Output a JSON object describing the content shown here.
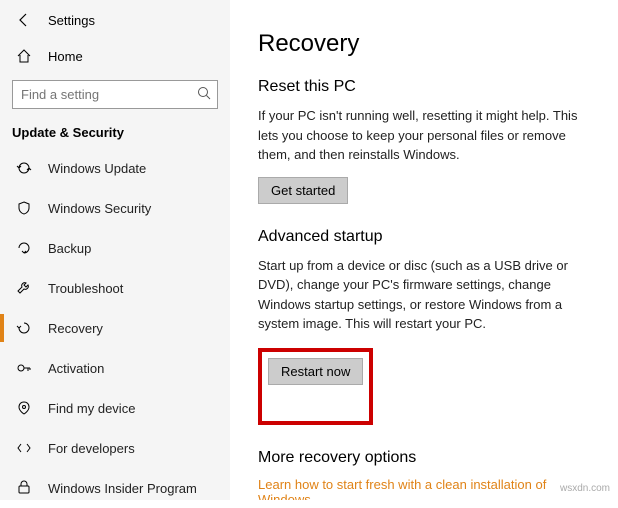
{
  "window": {
    "title": "Settings"
  },
  "sidebar": {
    "home": "Home",
    "search_placeholder": "Find a setting",
    "section": "Update & Security",
    "items": [
      {
        "label": "Windows Update"
      },
      {
        "label": "Windows Security"
      },
      {
        "label": "Backup"
      },
      {
        "label": "Troubleshoot"
      },
      {
        "label": "Recovery"
      },
      {
        "label": "Activation"
      },
      {
        "label": "Find my device"
      },
      {
        "label": "For developers"
      },
      {
        "label": "Windows Insider Program"
      }
    ]
  },
  "main": {
    "heading": "Recovery",
    "reset": {
      "title": "Reset this PC",
      "desc": "If your PC isn't running well, resetting it might help. This lets you choose to keep your personal files or remove them, and then reinstalls Windows.",
      "button": "Get started"
    },
    "advanced": {
      "title": "Advanced startup",
      "desc": "Start up from a device or disc (such as a USB drive or DVD), change your PC's firmware settings, change Windows startup settings, or restore Windows from a system image. This will restart your PC.",
      "button": "Restart now"
    },
    "more": {
      "title": "More recovery options",
      "link": "Learn how to start fresh with a clean installation of Windows"
    }
  },
  "watermark": "wsxdn.com"
}
